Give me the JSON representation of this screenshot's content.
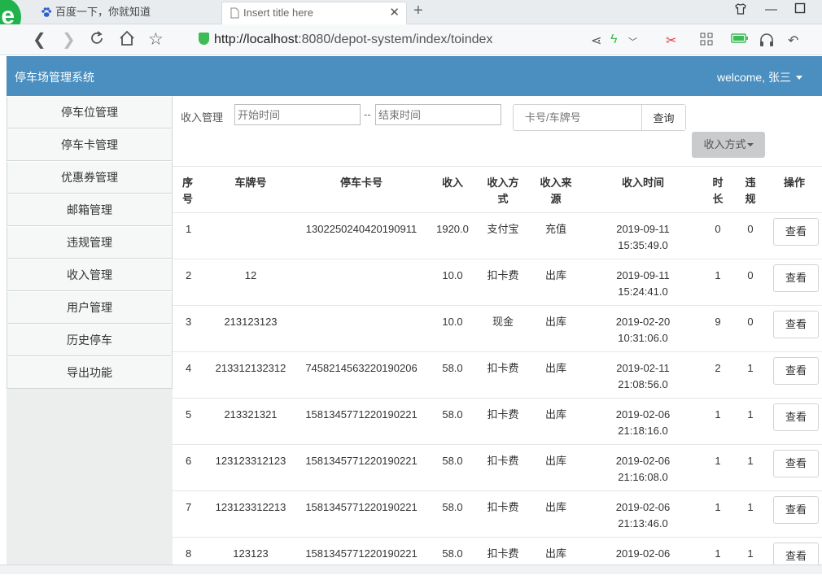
{
  "browser": {
    "tabs": [
      {
        "label": "百度一下，你就知道"
      },
      {
        "label": "Insert title here"
      }
    ],
    "url_host": "http://localhost",
    "url_path": ":8080/depot-system/index/toindex"
  },
  "header": {
    "title": "停车场管理系统",
    "welcome": "welcome, 张三"
  },
  "sidebar": {
    "items": [
      {
        "label": "停车位管理"
      },
      {
        "label": "停车卡管理"
      },
      {
        "label": "优惠券管理"
      },
      {
        "label": "邮箱管理"
      },
      {
        "label": "违规管理"
      },
      {
        "label": "收入管理"
      },
      {
        "label": "用户管理"
      },
      {
        "label": "历史停车"
      },
      {
        "label": "导出功能"
      }
    ]
  },
  "filters": {
    "label": "收入管理",
    "start_placeholder": "开始时间",
    "end_placeholder": "结束时间",
    "dash": "--",
    "search_placeholder": "卡号/车牌号",
    "search_button": "查询",
    "dropdown_label": "收入方式"
  },
  "table": {
    "headers": [
      "序号",
      "车牌号",
      "停车卡号",
      "收入",
      "收入方式",
      "收入来源",
      "收入时间",
      "时长",
      "违规",
      "操作"
    ],
    "rows": [
      {
        "no": "1",
        "plate": "",
        "card": "1302250240420190911",
        "income": "1920.0",
        "method": "支付宝",
        "source": "充值",
        "date": "2019-09-11",
        "time": "15:35:49.0",
        "duration": "0",
        "violation": "0",
        "action": "查看"
      },
      {
        "no": "2",
        "plate": "12",
        "card": "",
        "income": "10.0",
        "method": "扣卡费",
        "source": "出库",
        "date": "2019-09-11",
        "time": "15:24:41.0",
        "duration": "1",
        "violation": "0",
        "action": "查看"
      },
      {
        "no": "3",
        "plate": "213123123",
        "card": "",
        "income": "10.0",
        "method": "现金",
        "source": "出库",
        "date": "2019-02-20",
        "time": "10:31:06.0",
        "duration": "9",
        "violation": "0",
        "action": "查看"
      },
      {
        "no": "4",
        "plate": "213312132312",
        "card": "7458214563220190206",
        "income": "58.0",
        "method": "扣卡费",
        "source": "出库",
        "date": "2019-02-11",
        "time": "21:08:56.0",
        "duration": "2",
        "violation": "1",
        "action": "查看"
      },
      {
        "no": "5",
        "plate": "213321321",
        "card": "1581345771220190221",
        "income": "58.0",
        "method": "扣卡费",
        "source": "出库",
        "date": "2019-02-06",
        "time": "21:18:16.0",
        "duration": "1",
        "violation": "1",
        "action": "查看"
      },
      {
        "no": "6",
        "plate": "123123312123",
        "card": "1581345771220190221",
        "income": "58.0",
        "method": "扣卡费",
        "source": "出库",
        "date": "2019-02-06",
        "time": "21:16:08.0",
        "duration": "1",
        "violation": "1",
        "action": "查看"
      },
      {
        "no": "7",
        "plate": "123123312213",
        "card": "1581345771220190221",
        "income": "58.0",
        "method": "扣卡费",
        "source": "出库",
        "date": "2019-02-06",
        "time": "21:13:46.0",
        "duration": "1",
        "violation": "1",
        "action": "查看"
      },
      {
        "no": "8",
        "plate": "123123",
        "card": "1581345771220190221",
        "income": "58.0",
        "method": "扣卡费",
        "source": "出库",
        "date": "2019-02-06",
        "time": "",
        "duration": "1",
        "violation": "1",
        "action": "查看"
      }
    ]
  },
  "colors": {
    "header_bg": "#4a8fc0",
    "sidebar_bg": "#f6f7f7"
  }
}
